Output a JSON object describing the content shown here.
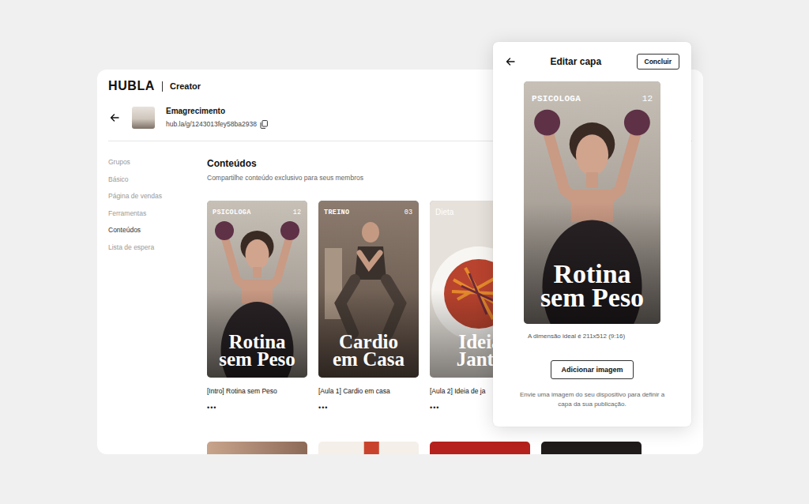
{
  "app": {
    "logo": "HUBLA",
    "section": "Creator"
  },
  "product": {
    "name": "Emagrecimento",
    "url": "hub.la/g/1243013fey58ba2938"
  },
  "sidebar": {
    "items": [
      {
        "label": "Grupos",
        "selected": false
      },
      {
        "label": "Básico",
        "selected": false
      },
      {
        "label": "Página de vendas",
        "selected": false
      },
      {
        "label": "Ferramentas",
        "selected": false
      },
      {
        "label": "Conteúdos",
        "selected": true
      },
      {
        "label": "Lista de espera",
        "selected": false
      }
    ]
  },
  "content": {
    "title": "Conteúdos",
    "subtitle": "Compartilhe conteúdo exclusivo para seus membros",
    "cards": [
      {
        "kind": "weights",
        "tag": "PSICOLOGA",
        "number": "12",
        "title_lines": [
          "Rotina",
          "sem Peso"
        ],
        "caption": "[Intro] Rotina sem Peso",
        "menu": "•••"
      },
      {
        "kind": "squat",
        "tag": "TREINO",
        "number": "03",
        "title_lines": [
          "Cardio",
          "em Casa"
        ],
        "caption": "[Aula 1] Cardio em casa",
        "menu": "•••"
      },
      {
        "kind": "plate",
        "tag": "Dieta",
        "title_lines": [
          "Ideia",
          "Janta"
        ],
        "caption": "[Aula 2] Ideia de ja",
        "menu": "•••"
      }
    ]
  },
  "editor": {
    "title": "Editar capa",
    "done": "Concluir",
    "preview": {
      "kind": "weights",
      "tag": "PSICOLOGA",
      "number": "12",
      "title_lines": [
        "Rotina",
        "sem Peso"
      ]
    },
    "hint": "A dimensão ideal é 211x512 (9:16)",
    "add_button": "Adicionar imagem",
    "description": "Envie uma imagem do seu dispositivo para definir a capa da sua publicação."
  }
}
